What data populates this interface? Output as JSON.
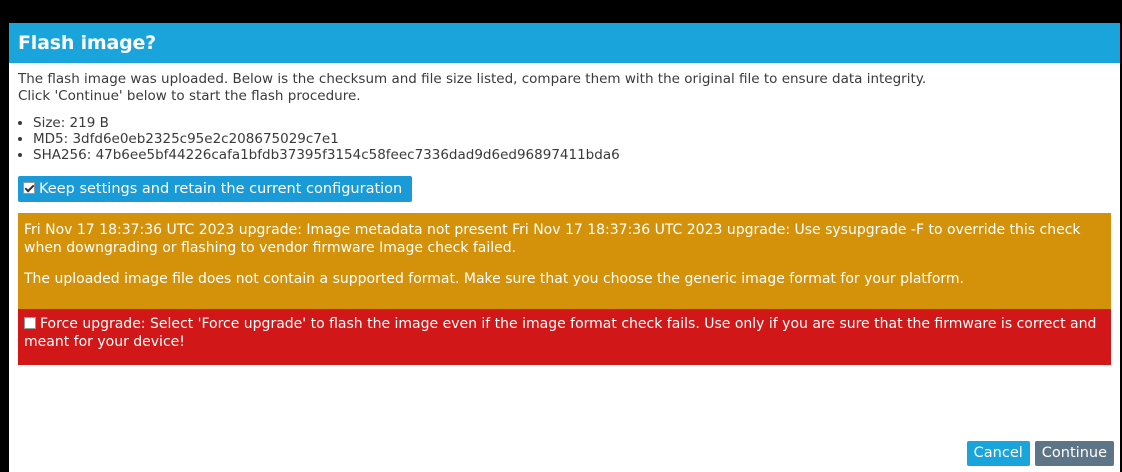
{
  "dialog": {
    "title": "Flash image?",
    "intro_line1": "The flash image was uploaded. Below is the checksum and file size listed, compare them with the original file to ensure data integrity.",
    "intro_line2": "Click 'Continue' below to start the flash procedure.",
    "info": [
      "Size: 219 B",
      "MD5: 3dfd6e0eb2325c95e2c208675029c7e1",
      "SHA256: 47b6ee5bf44226cafa1bfdb37395f3154c58feec7336dad9d6ed96897411bda6"
    ],
    "keep_settings": {
      "label": "Keep settings and retain the current configuration",
      "checked": true
    },
    "warning": {
      "line1": "Fri Nov 17 18:37:36 UTC 2023 upgrade: Image metadata not present Fri Nov 17 18:37:36 UTC 2023 upgrade: Use sysupgrade -F to override this check when downgrading or flashing to vendor firmware Image check failed.",
      "line2": "The uploaded image file does not contain a supported format. Make sure that you choose the generic image format for your platform."
    },
    "force": {
      "label": "Force upgrade: Select 'Force upgrade' to flash the image even if the image format check fails. Use only if you are sure that the firmware is correct and meant for your device!",
      "checked": false
    },
    "buttons": {
      "cancel": "Cancel",
      "continue": "Continue"
    }
  },
  "colors": {
    "header": "#1aa4dc",
    "warning": "#d3920a",
    "danger": "#d11717",
    "continue_button": "#5e7487"
  }
}
